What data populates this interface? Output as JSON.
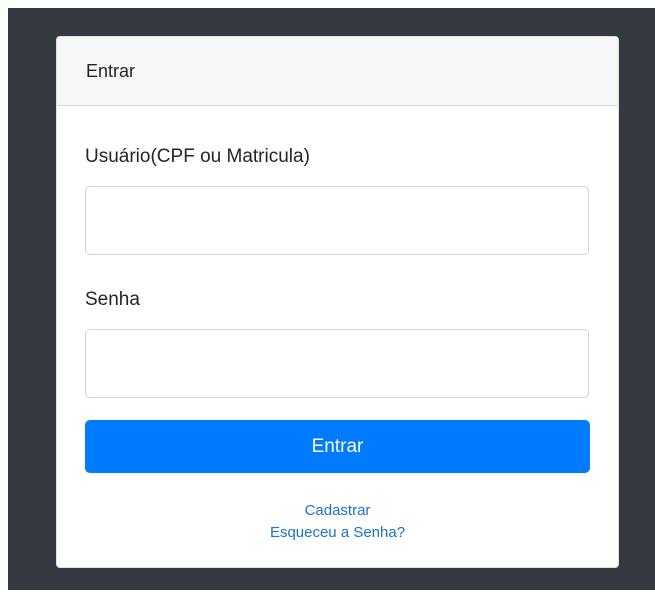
{
  "login_card": {
    "header_title": "Entrar",
    "username_label": "Usuário(CPF ou Matricula)",
    "username_value": "",
    "password_label": "Senha",
    "password_value": "",
    "submit_label": "Entrar",
    "register_link": "Cadastrar",
    "forgot_password_link": "Esqueceu a Senha?"
  },
  "colors": {
    "backdrop": "#343a40",
    "header_bg": "#f7f7f7",
    "primary_button": "#007bff",
    "link": "#1a73c8"
  }
}
